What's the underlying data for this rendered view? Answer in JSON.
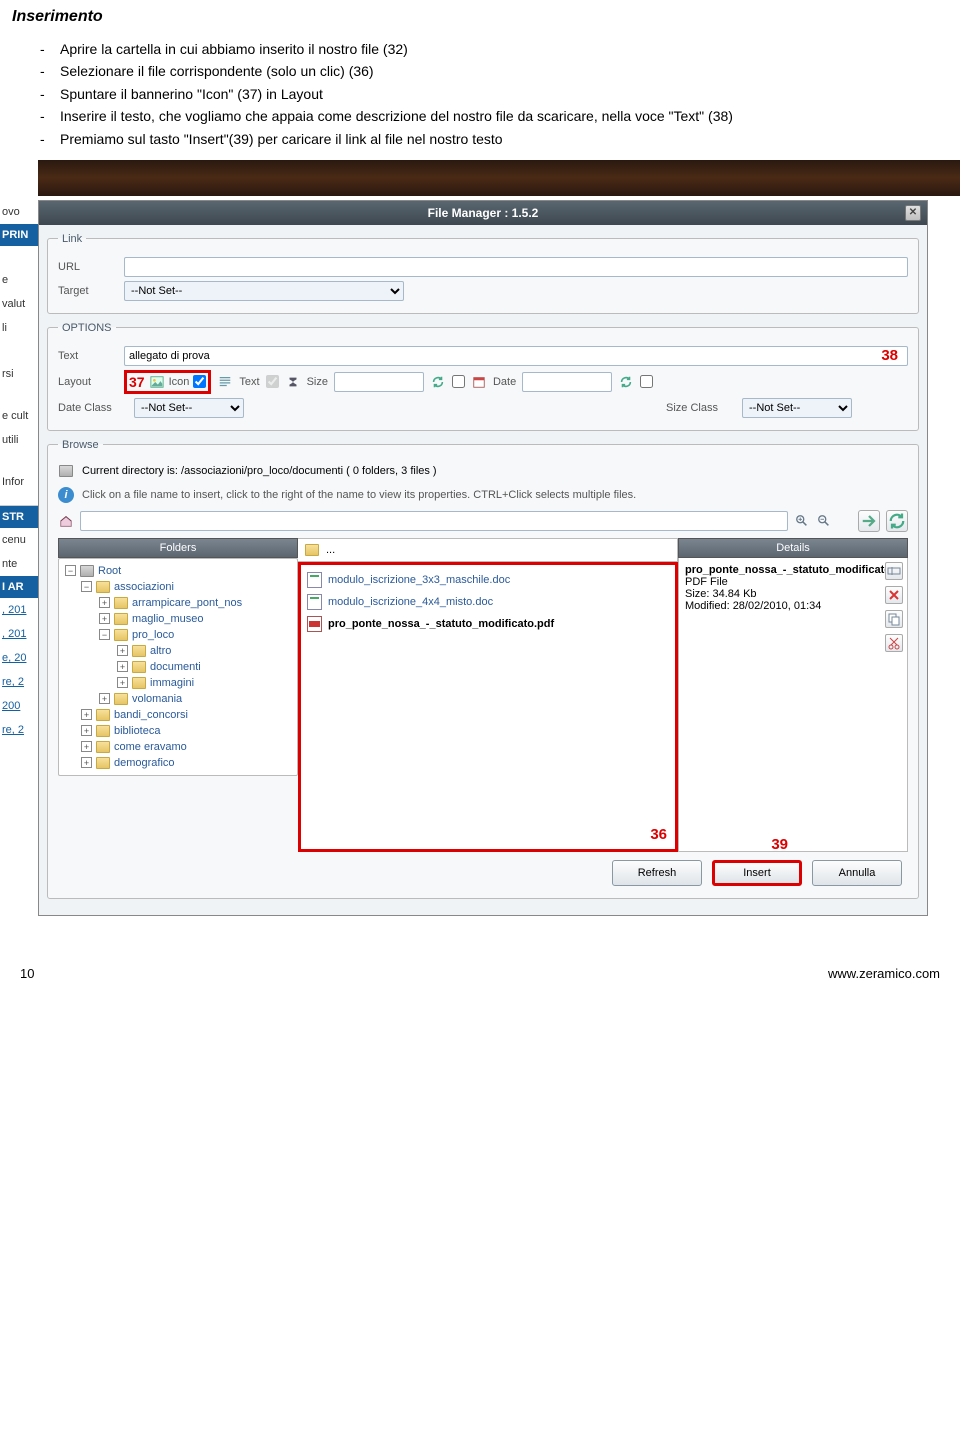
{
  "doc": {
    "heading": "Inserimento",
    "items": [
      "Aprire la cartella in cui abbiamo inserito il nostro file  (32)",
      "Selezionare il file corrispondente (solo un clic) (36)",
      "Spuntare il bannerino \"Icon\" (37) in Layout",
      "Inserire il testo, che vogliamo che appaia come descrizione del nostro file da scaricare, nella voce \"Text\" (38)",
      "Premiamo sul tasto \"Insert\"(39) per caricare il link al file nel nostro testo"
    ]
  },
  "leftSidebar": {
    "items": [
      "ovo",
      "PRIN",
      "e",
      "valut",
      "li",
      "rsi",
      "e cult",
      "utili",
      "Infor",
      "STR",
      "cenu",
      "nte",
      "I AR",
      ", 201",
      ", 201",
      "e, 20",
      "re, 2",
      " 200",
      "re, 2"
    ]
  },
  "dialog": {
    "title": "File Manager : 1.5.2",
    "link": {
      "legend": "Link",
      "urlLabel": "URL",
      "urlValue": "",
      "targetLabel": "Target",
      "targetValue": "--Not Set--"
    },
    "options": {
      "legend": "OPTIONS",
      "textLabel": "Text",
      "textValue": "allegato di prova",
      "layoutLabel": "Layout",
      "iconLabel": "Icon",
      "textChkLabel": "Text",
      "sizeLabel": "Size",
      "sizeValue": "",
      "dateLabel": "Date",
      "dateValue": "",
      "dateClassLabel": "Date Class",
      "dateClassValue": "--Not Set--",
      "sizeClassLabel": "Size Class",
      "sizeClassValue": "--Not Set--"
    },
    "browse": {
      "legend": "Browse",
      "pathText": "Current directory is: /associazioni/pro_loco/documenti ( 0 folders, 3 files )",
      "hint": "Click on a file name to insert, click to the right of the name to view its properties. CTRL+Click selects multiple files.",
      "searchValue": ""
    },
    "tree": {
      "header": "Folders",
      "root": "Root",
      "nodes": [
        {
          "name": "associazioni",
          "level": 1,
          "open": true
        },
        {
          "name": "arrampicare_pont_nos",
          "level": 2,
          "open": false
        },
        {
          "name": "maglio_museo",
          "level": 2,
          "open": false
        },
        {
          "name": "pro_loco",
          "level": 2,
          "open": true
        },
        {
          "name": "altro",
          "level": 3,
          "open": false
        },
        {
          "name": "documenti",
          "level": 3,
          "open": false
        },
        {
          "name": "immagini",
          "level": 3,
          "open": false
        },
        {
          "name": "volomania",
          "level": 2,
          "open": false
        },
        {
          "name": "bandi_concorsi",
          "level": 1,
          "open": false
        },
        {
          "name": "biblioteca",
          "level": 1,
          "open": false
        },
        {
          "name": "come eravamo",
          "level": 1,
          "open": false
        },
        {
          "name": "demografico",
          "level": 1,
          "open": false
        }
      ]
    },
    "files": {
      "up": "...",
      "list": [
        {
          "name": "modulo_iscrizione_3x3_maschile.doc",
          "type": "doc"
        },
        {
          "name": "modulo_iscrizione_4x4_misto.doc",
          "type": "doc"
        },
        {
          "name": "pro_ponte_nossa_-_statuto_modificato.pdf",
          "type": "pdf",
          "selected": true
        }
      ]
    },
    "details": {
      "header": "Details",
      "name": "pro_ponte_nossa_-_statuto_modificato",
      "type": "PDF File",
      "size": "Size: 34.84 Kb",
      "modified": "Modified: 28/02/2010, 01:34"
    },
    "buttons": {
      "refresh": "Refresh",
      "insert": "Insert",
      "cancel": "Annulla"
    },
    "annotations": {
      "a36": "36",
      "a37": "37",
      "a38": "38",
      "a39": "39"
    }
  },
  "footer": {
    "page": "10",
    "url": "www.zeramico.com"
  }
}
